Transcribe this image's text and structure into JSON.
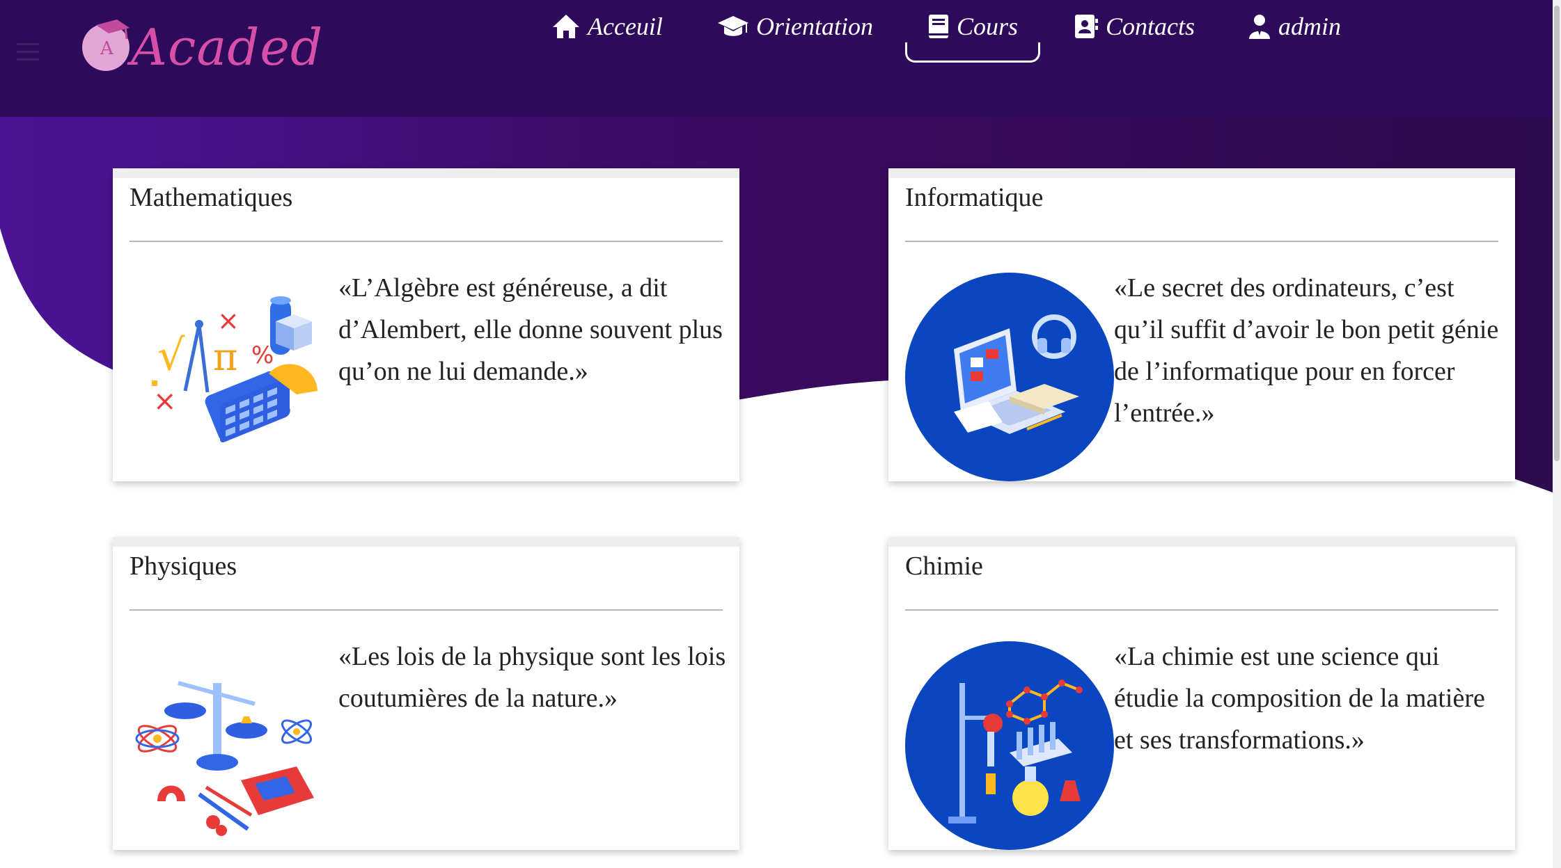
{
  "app": {
    "logo_text": "Acaded"
  },
  "nav": {
    "items": [
      {
        "label": "Acceuil",
        "icon": "home-icon"
      },
      {
        "label": "Orientation",
        "icon": "graduation-cap-icon"
      },
      {
        "label": "Cours",
        "icon": "book-icon",
        "active": true
      },
      {
        "label": "Contacts",
        "icon": "address-book-icon"
      },
      {
        "label": "admin",
        "icon": "user-icon"
      }
    ]
  },
  "colors": {
    "header": "#2e0a5a",
    "hero_gradient_start": "#4a1496",
    "hero_gradient_end": "#3a0a55",
    "logo": "#d64fa9",
    "illustration_blue": "#0a46c0"
  },
  "courses": [
    {
      "title": "Mathematiques",
      "quote": "«L’Algèbre est généreuse, a dit d’Alembert, elle donne souvent plus qu’on ne lui demande.»",
      "image_icon": "math-illustration-icon"
    },
    {
      "title": "Informatique",
      "quote": "«Le secret des ordinateurs, c’est qu’il suffit d’avoir le bon petit génie de l’informatique pour en forcer l’entrée.»",
      "image_icon": "computer-illustration-icon"
    },
    {
      "title": "Physiques",
      "quote": "«Les lois de la physique sont les lois coutumières de la nature.»",
      "image_icon": "physics-illustration-icon"
    },
    {
      "title": "Chimie",
      "quote": "«La chimie est une science qui étudie la composition de la matière et ses transformations.»",
      "image_icon": "chemistry-illustration-icon"
    }
  ]
}
